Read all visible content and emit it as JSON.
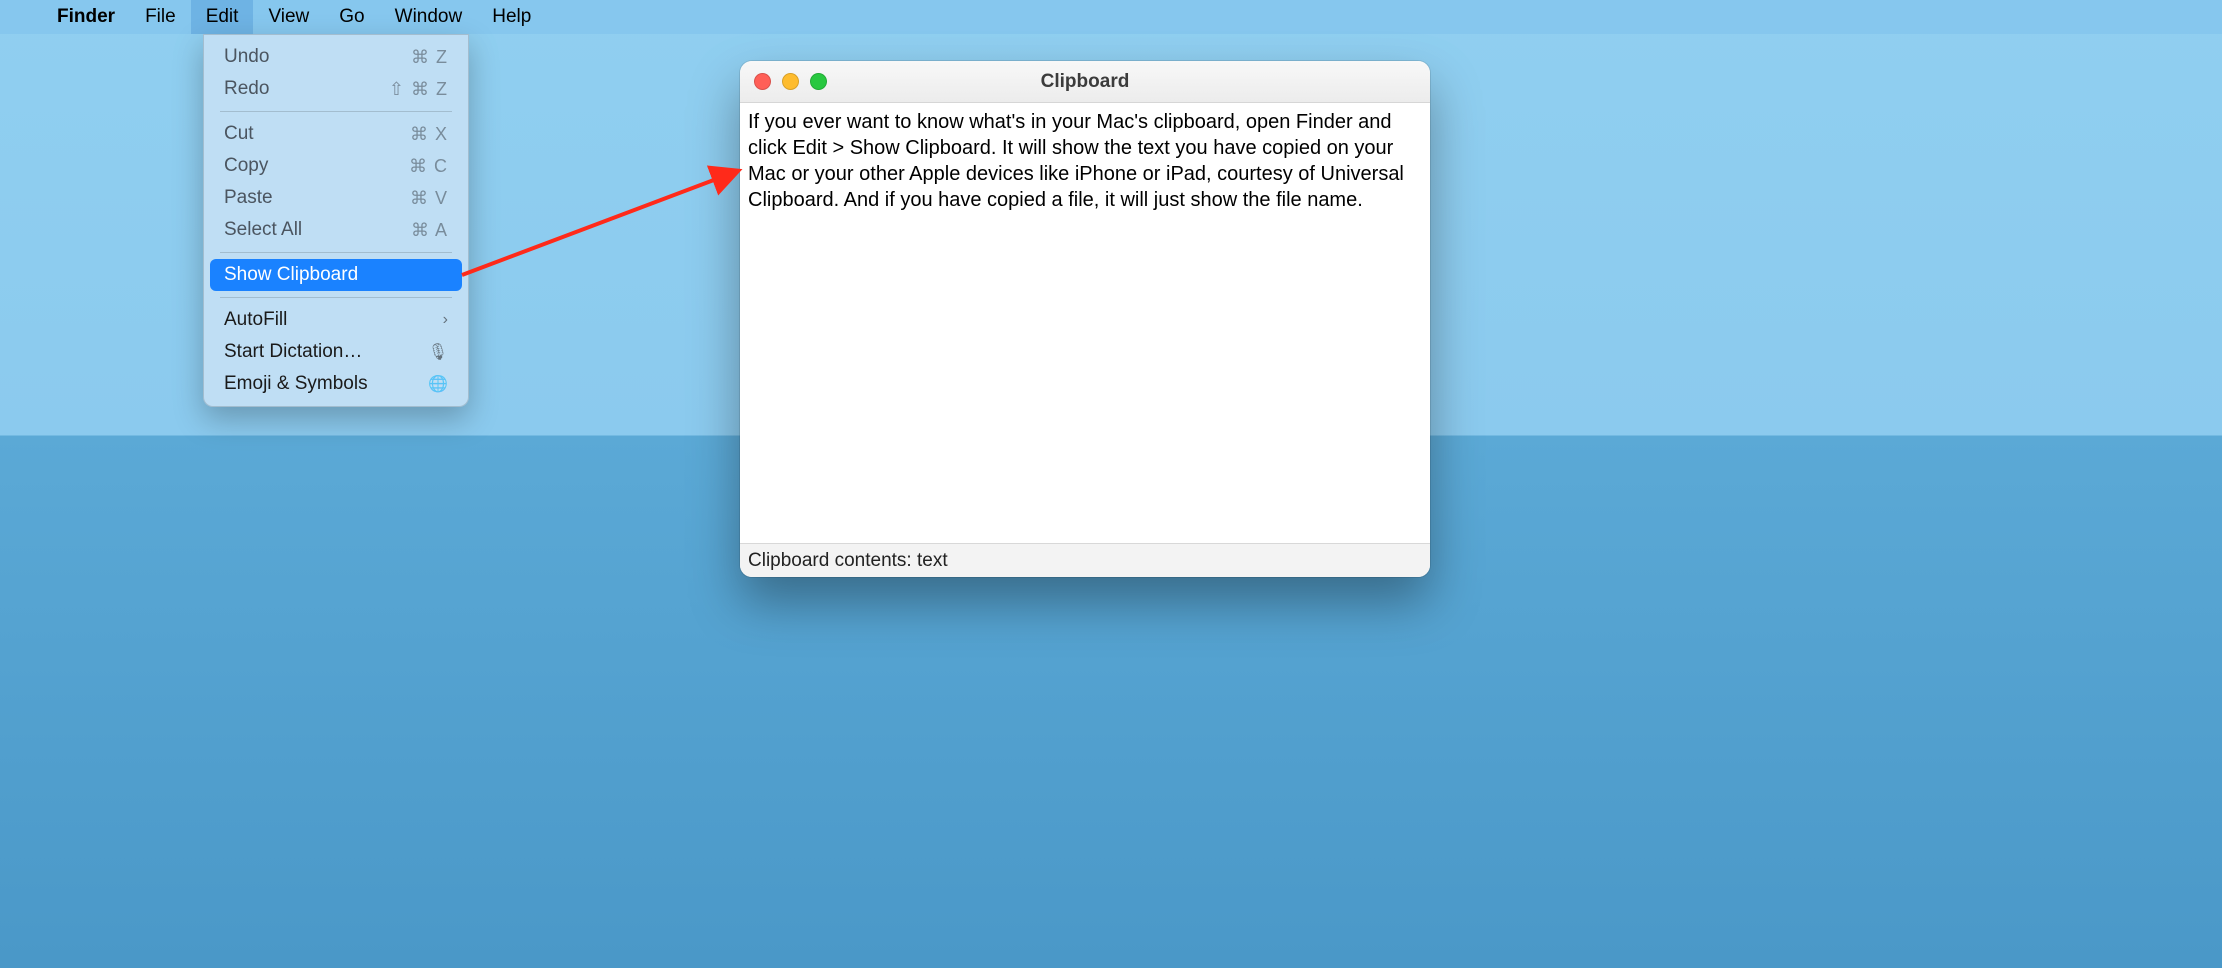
{
  "menubar": {
    "app": "Finder",
    "items": [
      "File",
      "Edit",
      "View",
      "Go",
      "Window",
      "Help"
    ],
    "open_index": 1
  },
  "dropdown": {
    "groups": [
      [
        {
          "label": "Undo",
          "shortcut": "⌘ Z",
          "enabled": false
        },
        {
          "label": "Redo",
          "shortcut": "⇧ ⌘ Z",
          "enabled": false
        }
      ],
      [
        {
          "label": "Cut",
          "shortcut": "⌘ X",
          "enabled": false
        },
        {
          "label": "Copy",
          "shortcut": "⌘ C",
          "enabled": false
        },
        {
          "label": "Paste",
          "shortcut": "⌘ V",
          "enabled": false
        },
        {
          "label": "Select All",
          "shortcut": "⌘ A",
          "enabled": false
        }
      ],
      [
        {
          "label": "Show Clipboard",
          "shortcut": "",
          "enabled": true,
          "highlight": true
        }
      ],
      [
        {
          "label": "AutoFill",
          "shortcut": "›",
          "enabled": true,
          "glyph": "chevron"
        },
        {
          "label": "Start Dictation…",
          "shortcut": "",
          "enabled": true,
          "glyph": "mic"
        },
        {
          "label": "Emoji & Symbols",
          "shortcut": "",
          "enabled": true,
          "glyph": "globe"
        }
      ]
    ]
  },
  "window": {
    "title": "Clipboard",
    "body": "If you ever want to know what's in your Mac's clipboard, open Finder and click Edit > Show Clipboard. It will show the text you have copied on your Mac or your other Apple devices like iPhone or iPad, courtesy of Universal Clipboard. And if you have copied a file, it will just show the file name.",
    "footer": "Clipboard contents: text"
  },
  "glyphs": {
    "chevron": "›",
    "mic": "🎙",
    "globe": "🌐"
  }
}
